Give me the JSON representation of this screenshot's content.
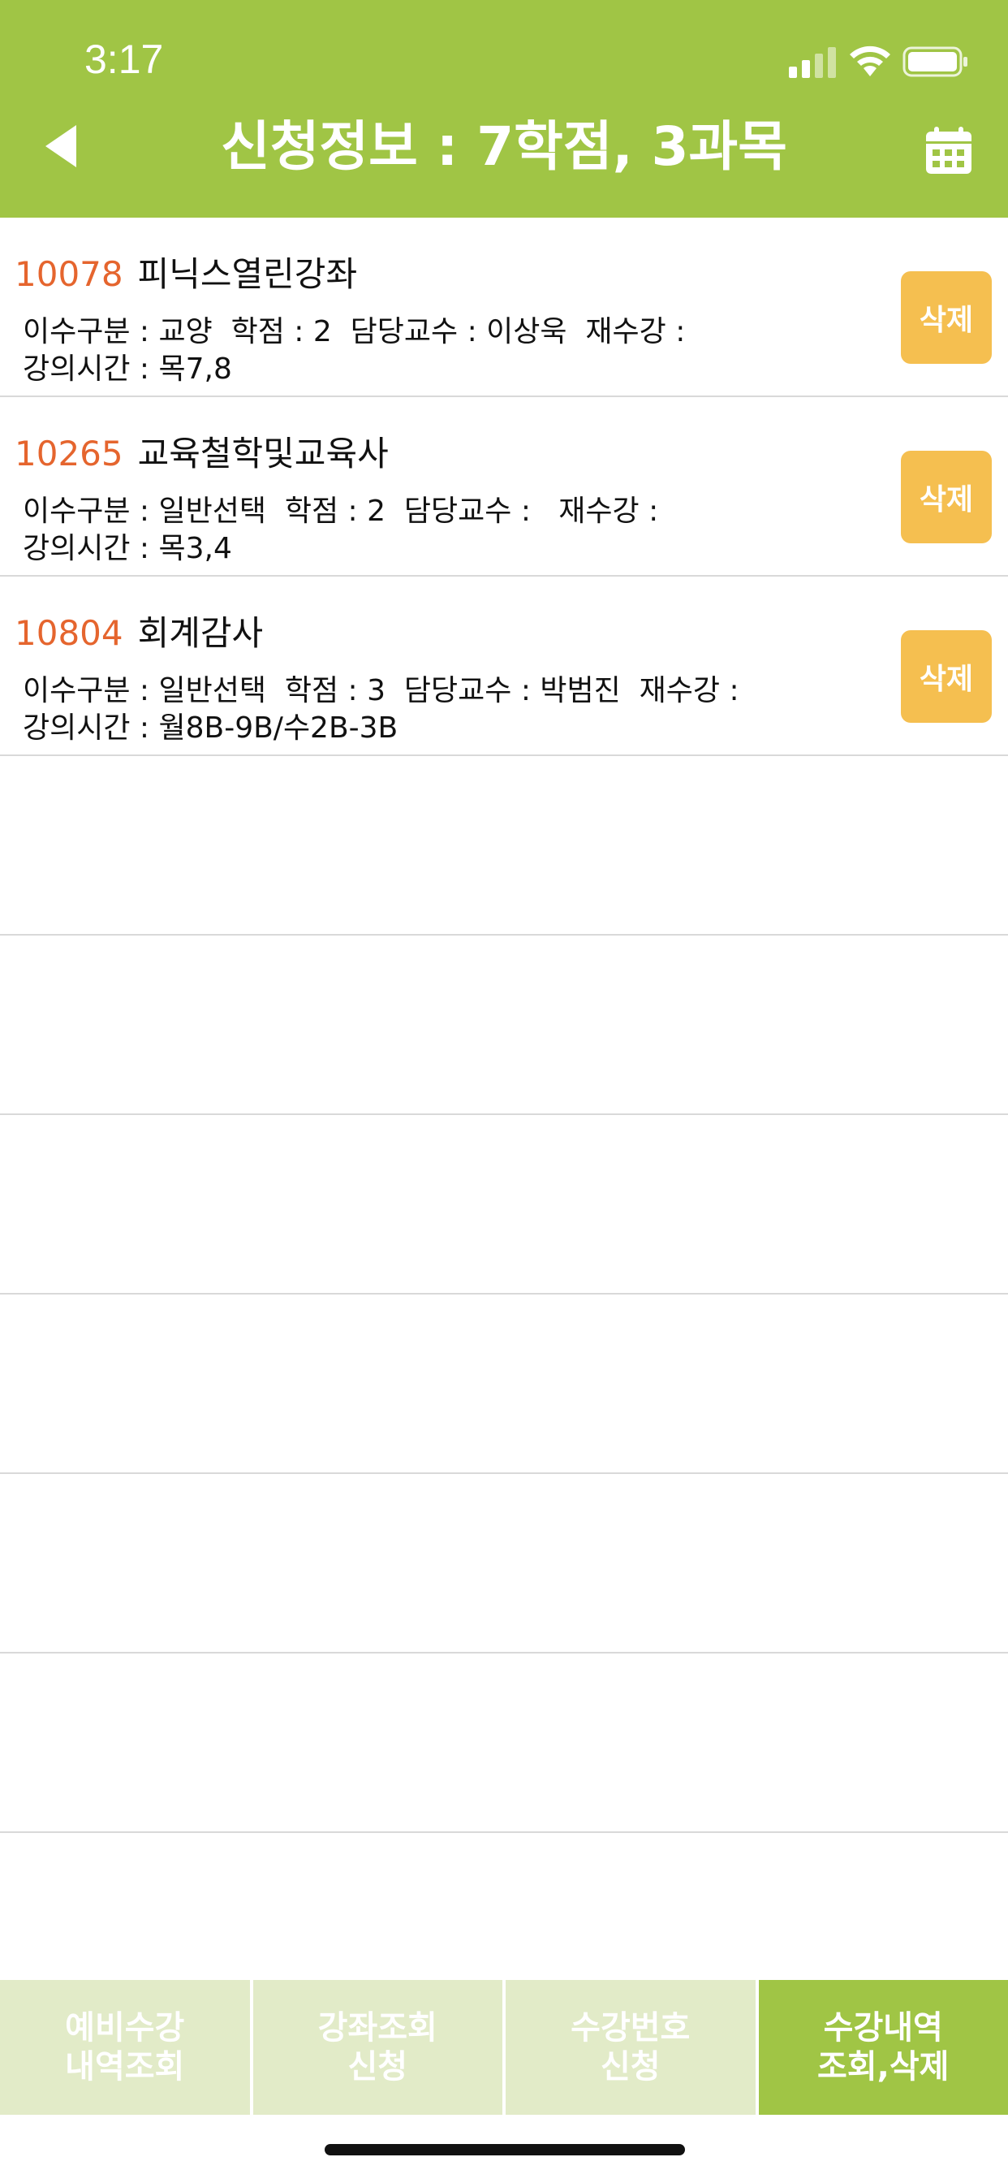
{
  "status_bar": {
    "time": "3:17"
  },
  "header": {
    "title": "신청정보 : 7학점,  3과목"
  },
  "courses": [
    {
      "code": "10078",
      "name": "피닉스열린강좌",
      "info_line1": "이수구분 : 교양  학점 : 2  담당교수 : 이상욱  재수강 :",
      "info_line2": "강의시간 : 목7,8",
      "delete_label": "삭제"
    },
    {
      "code": "10265",
      "name": "교육철학및교육사",
      "info_line1": "이수구분 : 일반선택  학점 : 2  담당교수 :   재수강 :",
      "info_line2": "강의시간 : 목3,4",
      "delete_label": "삭제"
    },
    {
      "code": "10804",
      "name": "회계감사",
      "info_line1": "이수구분 : 일반선택  학점 : 3  담당교수 : 박범진  재수강 :",
      "info_line2": "강의시간 : 월8B-9B/수2B-3B",
      "delete_label": "삭제"
    }
  ],
  "tabs": [
    {
      "label": "예비수강\n내역조회",
      "active": false
    },
    {
      "label": "강좌조회\n신청",
      "active": false
    },
    {
      "label": "수강번호\n신청",
      "active": false
    },
    {
      "label": "수강내역\n조회,삭제",
      "active": true
    }
  ],
  "colors": {
    "header_bg": "#a0c545",
    "course_code": "#e5652e",
    "delete_button": "#f5bf50",
    "tab_inactive": "#e2ebc8",
    "tab_active": "#a0c545"
  },
  "icons": {
    "back": "back-arrow-icon",
    "calendar": "calendar-icon",
    "signal": "cellular-signal-icon",
    "wifi": "wifi-icon",
    "battery": "battery-icon"
  }
}
